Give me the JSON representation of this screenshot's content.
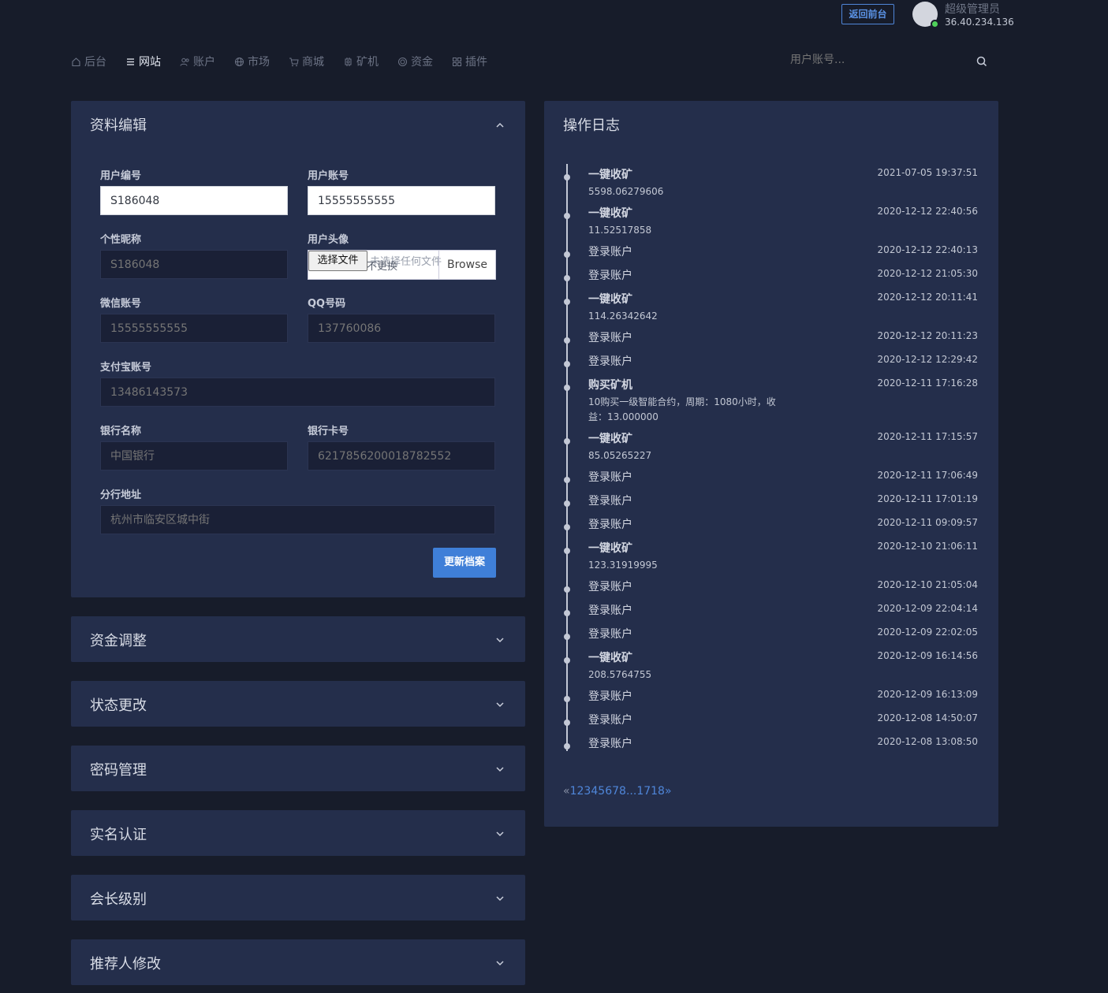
{
  "top": {
    "back_label": "返回前台",
    "user_name": "超级管理员",
    "user_ip": "36.40.234.136"
  },
  "nav": [
    {
      "label": "后台",
      "icon": "home-icon",
      "active": false
    },
    {
      "label": "网站",
      "icon": "list-icon",
      "active": true
    },
    {
      "label": "账户",
      "icon": "users-icon",
      "active": false
    },
    {
      "label": "市场",
      "icon": "globe-icon",
      "active": false
    },
    {
      "label": "商城",
      "icon": "cart-icon",
      "active": false
    },
    {
      "label": "矿机",
      "icon": "chip-icon",
      "active": false
    },
    {
      "label": "资金",
      "icon": "coin-icon",
      "active": false
    },
    {
      "label": "插件",
      "icon": "grid-icon",
      "active": false
    }
  ],
  "search": {
    "placeholder": "用户账号..."
  },
  "profile": {
    "title": "资料编辑",
    "user_id_label": "用户编号",
    "user_id_value": "S186048",
    "account_label": "用户账号",
    "account_value": "15555555555",
    "nickname_label": "个性昵称",
    "nickname_placeholder": "S186048",
    "avatar_label": "用户头像",
    "file_button": "选择文件",
    "file_text": "未选择任何文件",
    "file_hint": "不更换",
    "browse_label": "Browse",
    "wechat_label": "微信账号",
    "wechat_placeholder": "15555555555",
    "qq_label": "QQ号码",
    "qq_placeholder": "137760086",
    "alipay_label": "支付宝账号",
    "alipay_placeholder": "13486143573",
    "bank_name_label": "银行名称",
    "bank_name_placeholder": "中国银行",
    "bank_card_label": "银行卡号",
    "bank_card_placeholder": "6217856200018782552",
    "branch_label": "分行地址",
    "branch_placeholder": "杭州市临安区城中街",
    "submit_label": "更新档案"
  },
  "collapsed_panels": [
    "资金调整",
    "状态更改",
    "密码管理",
    "实名认证",
    "会长级别",
    "推荐人修改"
  ],
  "log": {
    "title": "操作日志",
    "entries": [
      {
        "title": "一键收矿",
        "bold": true,
        "detail": "5598.06279606",
        "time": "2021-07-05 19:37:51"
      },
      {
        "title": "一键收矿",
        "bold": true,
        "detail": "11.52517858",
        "time": "2020-12-12 22:40:56"
      },
      {
        "title": "登录账户",
        "bold": false,
        "detail": "",
        "time": "2020-12-12 22:40:13"
      },
      {
        "title": "登录账户",
        "bold": false,
        "detail": "",
        "time": "2020-12-12 21:05:30"
      },
      {
        "title": "一键收矿",
        "bold": true,
        "detail": "114.26342642",
        "time": "2020-12-12 20:11:41"
      },
      {
        "title": "登录账户",
        "bold": false,
        "detail": "",
        "time": "2020-12-12 20:11:23"
      },
      {
        "title": "登录账户",
        "bold": false,
        "detail": "",
        "time": "2020-12-12 12:29:42"
      },
      {
        "title": "购买矿机",
        "bold": true,
        "detail": "10购买一级智能合约，周期：1080小时，收益：13.000000",
        "time": "2020-12-11 17:16:28"
      },
      {
        "title": "一键收矿",
        "bold": true,
        "detail": "85.05265227",
        "time": "2020-12-11 17:15:57"
      },
      {
        "title": "登录账户",
        "bold": false,
        "detail": "",
        "time": "2020-12-11 17:06:49"
      },
      {
        "title": "登录账户",
        "bold": false,
        "detail": "",
        "time": "2020-12-11 17:01:19"
      },
      {
        "title": "登录账户",
        "bold": false,
        "detail": "",
        "time": "2020-12-11 09:09:57"
      },
      {
        "title": "一键收矿",
        "bold": true,
        "detail": "123.31919995",
        "time": "2020-12-10 21:06:11"
      },
      {
        "title": "登录账户",
        "bold": false,
        "detail": "",
        "time": "2020-12-10 21:05:04"
      },
      {
        "title": "登录账户",
        "bold": false,
        "detail": "",
        "time": "2020-12-09 22:04:14"
      },
      {
        "title": "登录账户",
        "bold": false,
        "detail": "",
        "time": "2020-12-09 22:02:05"
      },
      {
        "title": "一键收矿",
        "bold": true,
        "detail": "208.5764755",
        "time": "2020-12-09 16:14:56"
      },
      {
        "title": "登录账户",
        "bold": false,
        "detail": "",
        "time": "2020-12-09 16:13:09"
      },
      {
        "title": "登录账户",
        "bold": false,
        "detail": "",
        "time": "2020-12-08 14:50:07"
      },
      {
        "title": "登录账户",
        "bold": false,
        "detail": "",
        "time": "2020-12-08 13:08:50"
      }
    ],
    "pager": {
      "prev": "«",
      "pages": [
        "1",
        "2",
        "3",
        "4",
        "5",
        "6",
        "7",
        "8",
        "...",
        "17",
        "18"
      ],
      "next": "»"
    }
  }
}
